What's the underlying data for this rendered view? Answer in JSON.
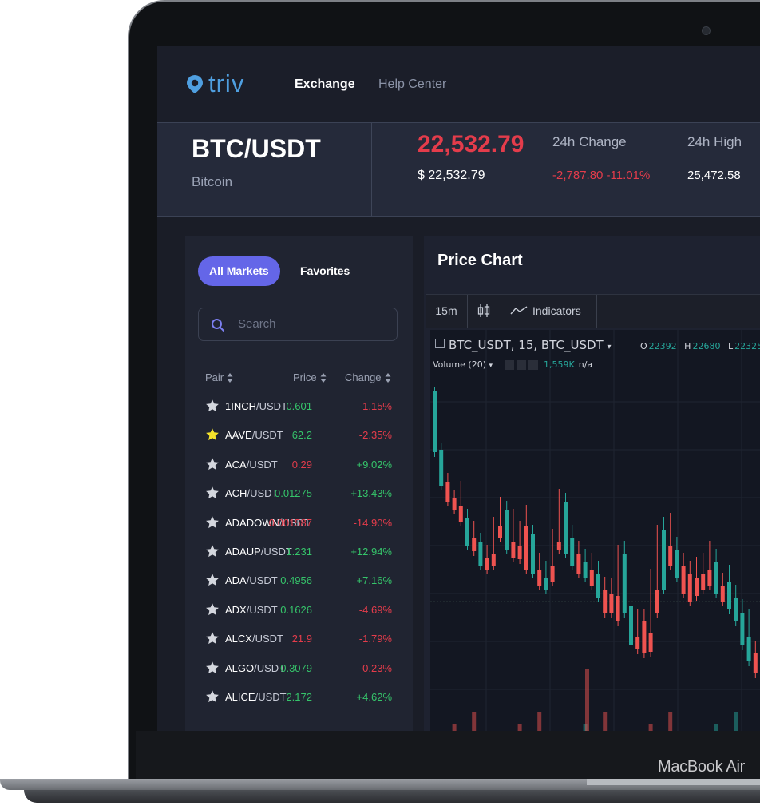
{
  "nav": {
    "logo_text": "triv",
    "links": [
      {
        "label": "Exchange",
        "active": true
      },
      {
        "label": "Help Center",
        "active": false
      }
    ]
  },
  "ticker": {
    "pair": "BTC/USDT",
    "name": "Bitcoin",
    "last_price": "22,532.79",
    "usd_price": "$ 22,532.79",
    "change_label": "24h Change",
    "change_value": "-2,787.80 -11.01%",
    "high_label": "24h High",
    "high_value": "25,472.58"
  },
  "market": {
    "tabs": [
      "All Markets",
      "Favorites"
    ],
    "search_placeholder": "Search",
    "columns": [
      "Pair",
      "Price",
      "Change"
    ],
    "rows": [
      {
        "base": "1INCH",
        "quote": "/USDT",
        "price": "0.601",
        "price_dir": "up",
        "change": "-1.15%",
        "change_dir": "down",
        "favorite": false
      },
      {
        "base": "AAVE",
        "quote": "/USDT",
        "price": "62.2",
        "price_dir": "up",
        "change": "-2.35%",
        "change_dir": "down",
        "favorite": true
      },
      {
        "base": "ACA",
        "quote": "/USDT",
        "price": "0.29",
        "price_dir": "down",
        "change": "+9.02%",
        "change_dir": "up",
        "favorite": false
      },
      {
        "base": "ACH",
        "quote": "/USDT",
        "price": "0.01275",
        "price_dir": "up",
        "change": "+13.43%",
        "change_dir": "up",
        "favorite": false
      },
      {
        "base": "ADADOWN",
        "quote": "/USDT",
        "price": "0.001587",
        "price_dir": "down",
        "change": "-14.90%",
        "change_dir": "down",
        "favorite": false
      },
      {
        "base": "ADAUP",
        "quote": "/USDT",
        "price": "1.231",
        "price_dir": "up",
        "change": "+12.94%",
        "change_dir": "up",
        "favorite": false
      },
      {
        "base": "ADA",
        "quote": "/USDT",
        "price": "0.4956",
        "price_dir": "up",
        "change": "+7.16%",
        "change_dir": "up",
        "favorite": false
      },
      {
        "base": "ADX",
        "quote": "/USDT",
        "price": "0.1626",
        "price_dir": "up",
        "change": "-4.69%",
        "change_dir": "down",
        "favorite": false
      },
      {
        "base": "ALCX",
        "quote": "/USDT",
        "price": "21.9",
        "price_dir": "down",
        "change": "-1.79%",
        "change_dir": "down",
        "favorite": false
      },
      {
        "base": "ALGO",
        "quote": "/USDT",
        "price": "0.3079",
        "price_dir": "up",
        "change": "-0.23%",
        "change_dir": "down",
        "favorite": false
      },
      {
        "base": "ALICE",
        "quote": "/USDT",
        "price": "2.172",
        "price_dir": "up",
        "change": "+4.62%",
        "change_dir": "up",
        "favorite": false
      }
    ]
  },
  "chart": {
    "title": "Price Chart",
    "interval": "15m",
    "indicators_label": "Indicators",
    "symbol_legend": "BTC_USDT, 15, BTC_USDT",
    "ohlc": [
      {
        "k": "O",
        "v": "22392"
      },
      {
        "k": "H",
        "v": "22680"
      },
      {
        "k": "L",
        "v": "22325"
      }
    ],
    "volume_label": "Volume (20)",
    "volume_value": "1,559K",
    "volume_na": "n/a",
    "candles": [
      [
        0,
        22,
        98,
        85,
        1
      ],
      [
        1,
        95,
        140,
        93,
        1
      ],
      [
        1,
        135,
        160,
        130,
        0
      ],
      [
        1,
        155,
        170,
        152,
        0
      ],
      [
        1,
        165,
        185,
        140,
        0
      ],
      [
        1,
        180,
        215,
        175,
        1
      ],
      [
        1,
        205,
        222,
        190,
        0
      ],
      [
        1,
        210,
        240,
        205,
        1
      ],
      [
        1,
        230,
        245,
        220,
        0
      ],
      [
        0,
        225,
        240,
        185,
        0
      ],
      [
        1,
        190,
        205,
        160,
        0
      ],
      [
        1,
        170,
        220,
        165,
        1
      ],
      [
        1,
        210,
        230,
        175,
        0
      ],
      [
        0,
        215,
        232,
        190,
        0
      ],
      [
        1,
        190,
        245,
        170,
        0
      ],
      [
        1,
        200,
        250,
        195,
        1
      ],
      [
        1,
        245,
        265,
        230,
        0
      ],
      [
        1,
        255,
        270,
        240,
        1
      ],
      [
        0,
        240,
        260,
        200,
        0
      ],
      [
        1,
        210,
        220,
        150,
        0
      ],
      [
        1,
        160,
        225,
        155,
        1
      ],
      [
        1,
        205,
        240,
        195,
        1
      ],
      [
        1,
        225,
        250,
        215,
        0
      ],
      [
        1,
        235,
        255,
        225,
        1
      ],
      [
        1,
        245,
        265,
        230,
        0
      ],
      [
        1,
        250,
        280,
        240,
        1
      ],
      [
        1,
        270,
        300,
        260,
        0
      ],
      [
        1,
        275,
        300,
        262,
        0
      ],
      [
        0,
        278,
        310,
        220,
        0
      ],
      [
        1,
        225,
        300,
        215,
        1
      ],
      [
        1,
        290,
        340,
        280,
        1
      ],
      [
        1,
        330,
        345,
        300,
        0
      ],
      [
        1,
        310,
        350,
        300,
        0
      ],
      [
        1,
        325,
        348,
        250,
        0
      ],
      [
        0,
        270,
        300,
        195,
        0
      ],
      [
        1,
        195,
        270,
        185,
        1
      ],
      [
        0,
        215,
        240,
        180,
        0
      ],
      [
        1,
        220,
        255,
        210,
        1
      ],
      [
        1,
        240,
        275,
        230,
        0
      ],
      [
        1,
        250,
        285,
        240,
        0
      ],
      [
        1,
        255,
        278,
        235,
        0
      ],
      [
        1,
        250,
        270,
        230,
        0
      ],
      [
        0,
        245,
        265,
        215,
        0
      ],
      [
        1,
        235,
        275,
        225,
        1
      ],
      [
        1,
        265,
        285,
        255,
        0
      ],
      [
        1,
        260,
        295,
        245,
        1
      ],
      [
        1,
        280,
        310,
        270,
        1
      ],
      [
        1,
        300,
        340,
        288,
        1
      ],
      [
        1,
        330,
        360,
        300,
        1
      ],
      [
        1,
        350,
        375,
        340,
        0
      ]
    ]
  }
}
